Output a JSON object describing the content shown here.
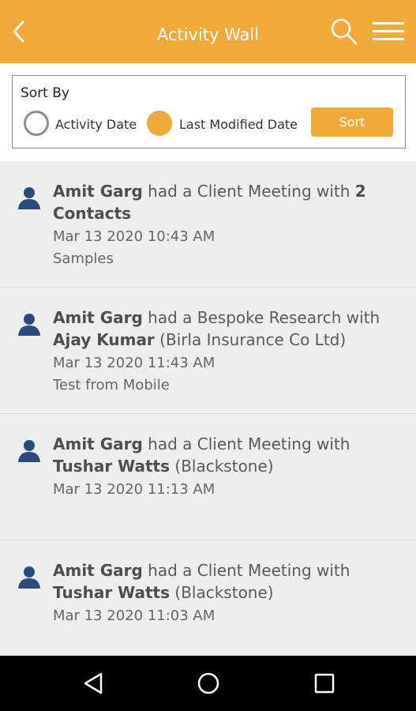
{
  "header": {
    "title": "Activity Wall"
  },
  "sort": {
    "label": "Sort By",
    "option_activity": "Activity Date",
    "option_modified": "Last Modified Date",
    "selected": "Last Modified Date",
    "button": "Sort"
  },
  "activities": [
    {
      "actor": "Amit Garg",
      "verb_a": " had a Client Meeting with ",
      "target1": "2",
      "line2_bold": "Contacts",
      "line2_rest": "",
      "date": "Mar 13 2020 10:43 AM",
      "note": "Samples"
    },
    {
      "actor": "Amit Garg",
      "verb_a": " had a Bespoke Research with",
      "target1": "",
      "line2_bold": "Ajay Kumar",
      "line2_rest": " (Birla Insurance Co Ltd)",
      "date": "Mar 13 2020 11:43 AM",
      "note": "Test from Mobile"
    },
    {
      "actor": "Amit Garg",
      "verb_a": " had a Client Meeting with",
      "target1": "",
      "line2_bold": "Tushar Watts",
      "line2_rest": " (Blackstone)",
      "date": "Mar 13 2020 11:13 AM",
      "note": ""
    },
    {
      "actor": "Amit Garg",
      "verb_a": " had a Client Meeting with",
      "target1": "",
      "line2_bold": "Tushar Watts",
      "line2_rest": " (Blackstone)",
      "date": "Mar 13 2020 11:03 AM",
      "note": ""
    }
  ],
  "colors": {
    "accent": "#F2A93B",
    "list_bg": "#EFEEEF",
    "avatar": "#2C4A7C"
  },
  "icons": [
    "back-icon",
    "search-icon",
    "menu-icon",
    "radio-icon",
    "person-icon",
    "nav-back-icon",
    "nav-home-icon",
    "nav-recents-icon"
  ]
}
